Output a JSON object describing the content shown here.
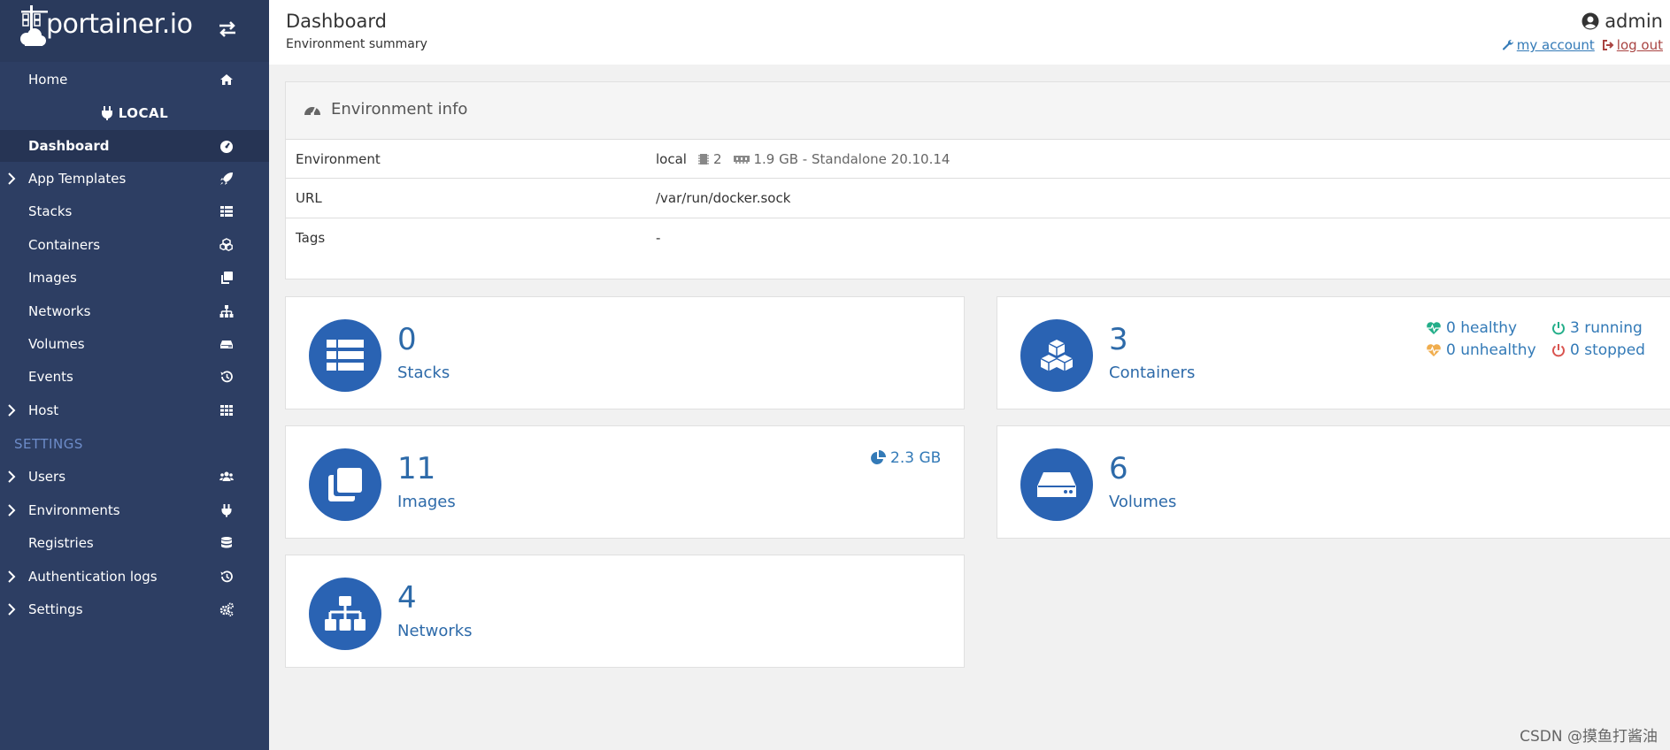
{
  "brand": {
    "name": "portainer.io"
  },
  "sidebar": {
    "home": "Home",
    "environment_name": "LOCAL",
    "items": [
      {
        "label": "Dashboard",
        "icon": "dashboard-icon"
      },
      {
        "label": "App Templates",
        "icon": "rocket-icon"
      },
      {
        "label": "Stacks",
        "icon": "list-icon"
      },
      {
        "label": "Containers",
        "icon": "cubes-icon"
      },
      {
        "label": "Images",
        "icon": "clone-icon"
      },
      {
        "label": "Networks",
        "icon": "sitemap-icon"
      },
      {
        "label": "Volumes",
        "icon": "hdd-icon"
      },
      {
        "label": "Events",
        "icon": "history-icon"
      },
      {
        "label": "Host",
        "icon": "grid-icon"
      }
    ],
    "settings_title": "SETTINGS",
    "settings_items": [
      {
        "label": "Users",
        "icon": "users-icon"
      },
      {
        "label": "Environments",
        "icon": "plug-icon"
      },
      {
        "label": "Registries",
        "icon": "database-icon"
      },
      {
        "label": "Authentication logs",
        "icon": "history-icon"
      },
      {
        "label": "Settings",
        "icon": "cogs-icon"
      }
    ]
  },
  "header": {
    "title": "Dashboard",
    "subtitle": "Environment summary",
    "username": "admin",
    "my_account": "my account",
    "log_out": "log out"
  },
  "env_info": {
    "title": "Environment info",
    "rows": [
      {
        "key": "Environment",
        "name": "local",
        "cpu": "2",
        "memory": "1.9 GB - Standalone 20.10.14"
      },
      {
        "key": "URL",
        "value": "/var/run/docker.sock"
      },
      {
        "key": "Tags",
        "value": "-"
      }
    ]
  },
  "stats": {
    "stacks": {
      "value": "0",
      "label": "Stacks"
    },
    "containers": {
      "value": "3",
      "label": "Containers",
      "healthy": "0 healthy",
      "unhealthy": "0 unhealthy",
      "running": "3 running",
      "stopped": "0 stopped"
    },
    "images": {
      "value": "11",
      "label": "Images",
      "size": "2.3 GB"
    },
    "volumes": {
      "value": "6",
      "label": "Volumes"
    },
    "networks": {
      "value": "4",
      "label": "Networks"
    }
  },
  "colors": {
    "sidebar": "#2d3e63",
    "accent": "#2a63b3",
    "healthy": "#23ae89",
    "unhealthy": "#f0ad4e",
    "stopped": "#d9534f"
  },
  "watermark": "CSDN @摸鱼打酱油"
}
